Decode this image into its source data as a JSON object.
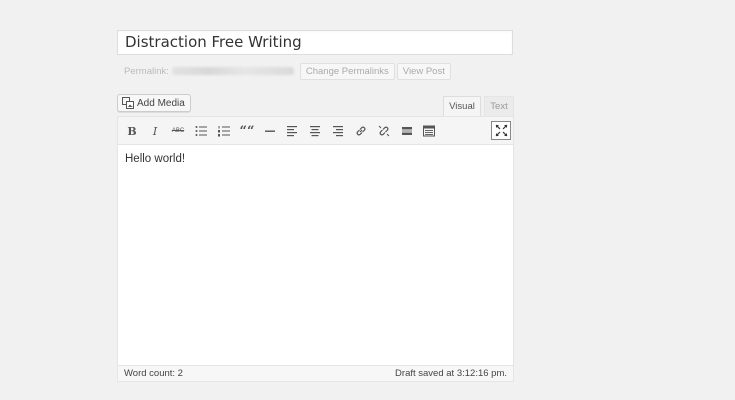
{
  "post": {
    "title": "Distraction Free Writing",
    "permalink_label": "Permalink:",
    "change_permalinks": "Change Permalinks",
    "view_post": "View Post"
  },
  "media": {
    "add_media_label": "Add Media",
    "icon": "media-icon"
  },
  "tabs": {
    "visual": "Visual",
    "text": "Text",
    "active": "Visual"
  },
  "toolbar": {
    "bold": "B",
    "italic": "I",
    "strikethrough": "ABC",
    "blockquote": "““",
    "buttons": [
      "bold",
      "italic",
      "strikethrough",
      "bulleted-list",
      "numbered-list",
      "blockquote",
      "horizontal-line",
      "align-left",
      "align-center",
      "align-right",
      "insert-link",
      "remove-link",
      "read-more",
      "toolbar-toggle",
      "distraction-free-writing"
    ]
  },
  "editor": {
    "content": "Hello world!"
  },
  "status": {
    "word_count": "Word count: 2",
    "draft_saved": "Draft saved at 3:12:16 pm."
  }
}
